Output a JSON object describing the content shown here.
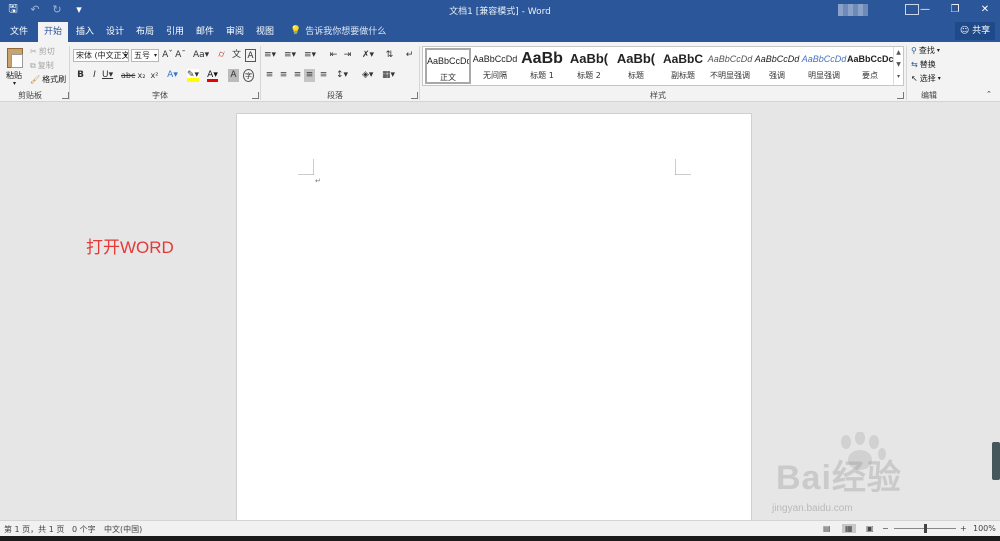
{
  "window": {
    "title": "文档1 [兼容模式] - Word",
    "controls": [
      "minimize-icon",
      "restore-icon",
      "close-icon"
    ]
  },
  "qat": {
    "icons": [
      "save-icon",
      "undo-icon",
      "redo-icon",
      "customize-icon"
    ]
  },
  "tabs": [
    {
      "label": "文件",
      "active": false
    },
    {
      "label": "开始",
      "active": true
    },
    {
      "label": "插入",
      "active": false
    },
    {
      "label": "设计",
      "active": false
    },
    {
      "label": "布局",
      "active": false
    },
    {
      "label": "引用",
      "active": false
    },
    {
      "label": "邮件",
      "active": false
    },
    {
      "label": "审阅",
      "active": false
    },
    {
      "label": "视图",
      "active": false
    }
  ],
  "tell_me": {
    "placeholder": "告诉我你想要做什么"
  },
  "share": {
    "label": "共享"
  },
  "clipboard": {
    "paste": "粘贴",
    "cut": "剪切",
    "copy": "复制",
    "format_painter": "格式刷",
    "group_label": "剪贴板"
  },
  "font": {
    "name": "宋体 (中文正文)",
    "size": "五号",
    "group_label": "字体"
  },
  "paragraph": {
    "group_label": "段落"
  },
  "styles": {
    "group_label": "样式",
    "items": [
      {
        "sample": "AaBbCcDd",
        "name": "正文",
        "selected": true
      },
      {
        "sample": "AaBbCcDd",
        "name": "无间隔",
        "selected": false
      },
      {
        "sample": "AaBb",
        "name": "标题 1",
        "selected": false
      },
      {
        "sample": "AaBb(",
        "name": "标题 2",
        "selected": false
      },
      {
        "sample": "AaBb(",
        "name": "标题",
        "selected": false
      },
      {
        "sample": "AaBbC",
        "name": "副标题",
        "selected": false
      },
      {
        "sample": "AaBbCcDd",
        "name": "不明显强调",
        "selected": false
      },
      {
        "sample": "AaBbCcDd",
        "name": "强调",
        "selected": false
      },
      {
        "sample": "AaBbCcDd",
        "name": "明显强调",
        "selected": false
      },
      {
        "sample": "AaBbCcDc",
        "name": "要点",
        "selected": false
      }
    ]
  },
  "editing": {
    "find": "查找",
    "replace": "替换",
    "select": "选择",
    "group_label": "编辑"
  },
  "annotation": {
    "text": "打开WORD",
    "color": "#e53935"
  },
  "watermark": {
    "logo": "Bai经验",
    "site": "jingyan.baidu.com"
  },
  "status": {
    "page": "第 1 页，共 1 页",
    "words": "0 个字",
    "language": "中文(中国)",
    "zoom": "100%",
    "zoom_fraction": 0.5
  },
  "colors": {
    "accent": "#2b579a",
    "ribbon": "#f3f3f3",
    "canvas": "#e6e6e6"
  }
}
